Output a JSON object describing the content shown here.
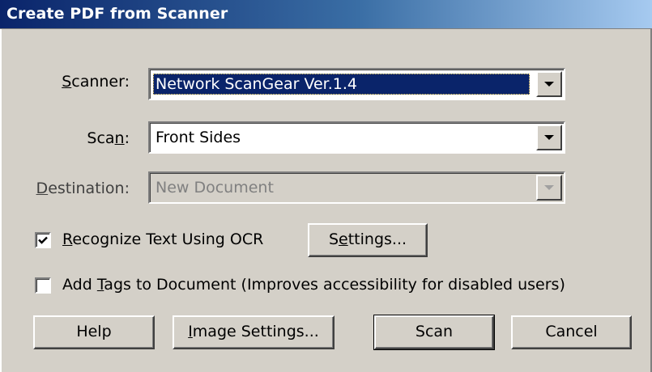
{
  "window": {
    "title": "Create PDF from Scanner"
  },
  "scanner": {
    "label_pre": "",
    "label_key": "S",
    "label_post": "canner:",
    "value": "Network ScanGear Ver.1.4"
  },
  "scan": {
    "label_pre": "Sca",
    "label_key": "n",
    "label_post": ":",
    "value": "Front Sides"
  },
  "destination": {
    "label_pre": "",
    "label_key": "D",
    "label_post": "estination:",
    "value": "New Document"
  },
  "ocr": {
    "checked": true,
    "label_pre": "",
    "label_key": "R",
    "label_post": "ecognize Text Using OCR"
  },
  "settings_button": {
    "label_pre": "S",
    "label_key": "e",
    "label_post": "ttings..."
  },
  "tags": {
    "checked": false,
    "label_pre": "Add ",
    "label_key": "T",
    "label_post": "ags to Document (Improves accessibility for disabled users)"
  },
  "buttons": {
    "help": "Help",
    "image_settings_pre": "",
    "image_settings_key": "I",
    "image_settings_post": "mage Settings...",
    "scan": "Scan",
    "cancel": "Cancel"
  },
  "icons": {
    "dropdown": "chevron-down-icon",
    "check": "checkmark-icon"
  }
}
